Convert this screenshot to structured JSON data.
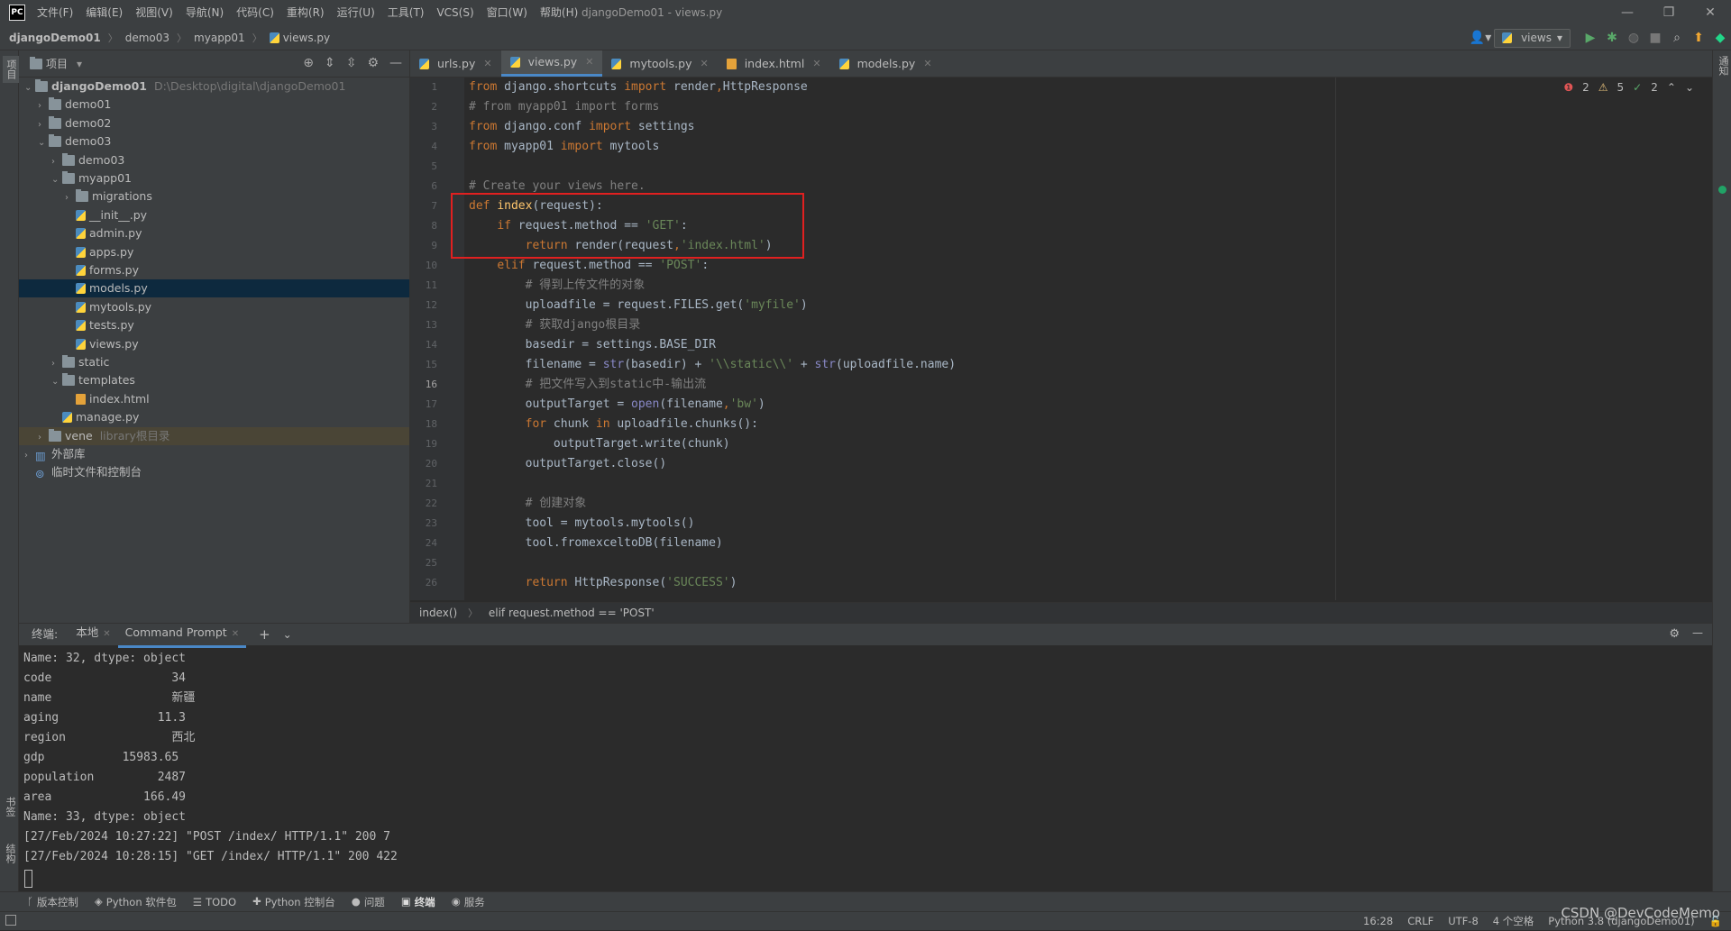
{
  "app": {
    "logo": "PC",
    "window_title": "djangoDemo01 - views.py"
  },
  "menu": [
    "文件(F)",
    "编辑(E)",
    "视图(V)",
    "导航(N)",
    "代码(C)",
    "重构(R)",
    "运行(U)",
    "工具(T)",
    "VCS(S)",
    "窗口(W)",
    "帮助(H)"
  ],
  "window_controls": {
    "minimize": "—",
    "maximize": "❐",
    "close": "✕"
  },
  "breadcrumb": [
    "djangoDemo01",
    "demo03",
    "myapp01",
    "views.py"
  ],
  "run_config": "views",
  "project_panel": {
    "title": "项目",
    "tree": [
      {
        "label": "djangoDemo01",
        "hint": "D:\\Desktop\\digital\\djangoDemo01",
        "type": "folder",
        "depth": 0,
        "open": true
      },
      {
        "label": "demo01",
        "type": "folder",
        "depth": 1,
        "open": false
      },
      {
        "label": "demo02",
        "type": "folder",
        "depth": 1,
        "open": false
      },
      {
        "label": "demo03",
        "type": "folder",
        "depth": 1,
        "open": true
      },
      {
        "label": "demo03",
        "type": "folder",
        "depth": 2,
        "open": false
      },
      {
        "label": "myapp01",
        "type": "folder",
        "depth": 2,
        "open": true
      },
      {
        "label": "migrations",
        "type": "folder",
        "depth": 3,
        "open": false
      },
      {
        "label": "__init__.py",
        "type": "py",
        "depth": 3
      },
      {
        "label": "admin.py",
        "type": "py",
        "depth": 3
      },
      {
        "label": "apps.py",
        "type": "py",
        "depth": 3
      },
      {
        "label": "forms.py",
        "type": "py",
        "depth": 3
      },
      {
        "label": "models.py",
        "type": "py",
        "depth": 3,
        "selected": true
      },
      {
        "label": "mytools.py",
        "type": "py",
        "depth": 3
      },
      {
        "label": "tests.py",
        "type": "py",
        "depth": 3
      },
      {
        "label": "views.py",
        "type": "py",
        "depth": 3
      },
      {
        "label": "static",
        "type": "folder",
        "depth": 2,
        "open": false
      },
      {
        "label": "templates",
        "type": "folder",
        "depth": 2,
        "open": true
      },
      {
        "label": "index.html",
        "type": "html",
        "depth": 3
      },
      {
        "label": "manage.py",
        "type": "py",
        "depth": 2
      },
      {
        "label": "vene",
        "hint": "library根目录",
        "type": "folder",
        "depth": 1,
        "open": false,
        "excluded": true
      },
      {
        "label": "外部库",
        "type": "lib",
        "depth": 0,
        "open": false
      },
      {
        "label": "临时文件和控制台",
        "type": "scratch",
        "depth": 0
      }
    ]
  },
  "editor_tabs": [
    {
      "label": "urls.py",
      "active": false
    },
    {
      "label": "views.py",
      "active": true
    },
    {
      "label": "mytools.py",
      "active": false
    },
    {
      "label": "index.html",
      "active": false
    },
    {
      "label": "models.py",
      "active": false
    }
  ],
  "inspections": {
    "errors": "2",
    "warnings": "5",
    "ok": "2"
  },
  "code_lines": [
    {
      "n": "1",
      "html": "<span class=kw>from</span> django.shortcuts <span class=kw>import</span> render<span class=kw>,</span>HttpResponse"
    },
    {
      "n": "2",
      "html": "<span class=cm># from myapp01 import forms</span>"
    },
    {
      "n": "3",
      "html": "<span class=kw>from</span> django.conf <span class=kw>import</span> settings"
    },
    {
      "n": "4",
      "html": "<span class=kw>from</span> myapp01 <span class=kw>import</span> mytools"
    },
    {
      "n": "5",
      "html": ""
    },
    {
      "n": "6",
      "html": "<span class=cm># Create your views here.</span>"
    },
    {
      "n": "7",
      "html": "<span class=kw>def</span> <span class=fn>index</span>(request):"
    },
    {
      "n": "8",
      "html": "    <span class=kw>if</span> request.method == <span class=str>'GET'</span>:"
    },
    {
      "n": "9",
      "html": "        <span class=kw>return</span> render(request<span class=kw>,</span><span class=str>'index.html'</span>)"
    },
    {
      "n": "10",
      "html": "    <span class=kw>elif</span> request.method == <span class=str>'POST'</span>:"
    },
    {
      "n": "11",
      "html": "        <span class=cm># 得到上传文件的对象</span>"
    },
    {
      "n": "12",
      "html": "        uploadfile = request.FILES.get(<span class=str>'myfile'</span>)"
    },
    {
      "n": "13",
      "html": "        <span class=cm># 获取django根目录</span>"
    },
    {
      "n": "14",
      "html": "        basedir = settings.BASE_DIR"
    },
    {
      "n": "15",
      "html": "        filename = <span class=bi>str</span>(basedir) + <span class=str>'\\\\static\\\\'</span> + <span class=bi>str</span>(uploadfile.name)"
    },
    {
      "n": "16",
      "html": "        <span class=cm># 把文件写入到static中-输出流</span>"
    },
    {
      "n": "17",
      "html": "        outputTarget = <span class=bi>open</span>(filename<span class=kw>,</span><span class=str>'bw'</span>)"
    },
    {
      "n": "18",
      "html": "        <span class=kw>for</span> chunk <span class=kw>in</span> uploadfile.chunks():"
    },
    {
      "n": "19",
      "html": "            outputTarget.write(chunk)"
    },
    {
      "n": "20",
      "html": "        outputTarget.close()"
    },
    {
      "n": "21",
      "html": ""
    },
    {
      "n": "22",
      "html": "        <span class=cm># 创建对象</span>"
    },
    {
      "n": "23",
      "html": "        tool = mytools.mytools()"
    },
    {
      "n": "24",
      "html": "        tool.fromexceltoDB(filename)"
    },
    {
      "n": "25",
      "html": ""
    },
    {
      "n": "26",
      "html": "        <span class=kw>return</span> HttpResponse(<span class=str>'SUCCESS'</span>)"
    }
  ],
  "editor_breadcrumb": [
    "index()",
    "elif request.method == 'POST'"
  ],
  "terminal": {
    "label": "终端:",
    "tabs": [
      {
        "label": "本地",
        "active": false
      },
      {
        "label": "Command Prompt",
        "active": true
      }
    ],
    "lines": [
      "Name: 32, dtype: object",
      "code                 34",
      "name                 新疆",
      "aging              11.3",
      "region               西北",
      "gdp           15983.65",
      "population         2487",
      "area             166.49",
      "Name: 33, dtype: object",
      "[27/Feb/2024 10:27:22] \"POST /index/ HTTP/1.1\" 200 7",
      "[27/Feb/2024 10:28:15] \"GET /index/ HTTP/1.1\" 200 422"
    ]
  },
  "tool_windows": [
    {
      "label": "版本控制",
      "icon": "ᚴ"
    },
    {
      "label": "Python 软件包",
      "icon": "◈"
    },
    {
      "label": "TODO",
      "icon": "☰"
    },
    {
      "label": "Python 控制台",
      "icon": "✚"
    },
    {
      "label": "问题",
      "icon": "●"
    },
    {
      "label": "终端",
      "icon": "▣",
      "active": true
    },
    {
      "label": "服务",
      "icon": "◉"
    }
  ],
  "left_strip": [
    "项目",
    "书签",
    "结构"
  ],
  "right_strip": [
    "通知"
  ],
  "status": {
    "position": "16:28",
    "line_sep": "CRLF",
    "encoding": "UTF-8",
    "indent": "4 个空格",
    "interpreter": "Python 3.8 (djangoDemo01)"
  },
  "watermark": "CSDN @DevCodeMemo",
  "colors": {
    "accent": "#4a88c7",
    "highlight_box": "#e02020",
    "selection": "#0d293e"
  }
}
